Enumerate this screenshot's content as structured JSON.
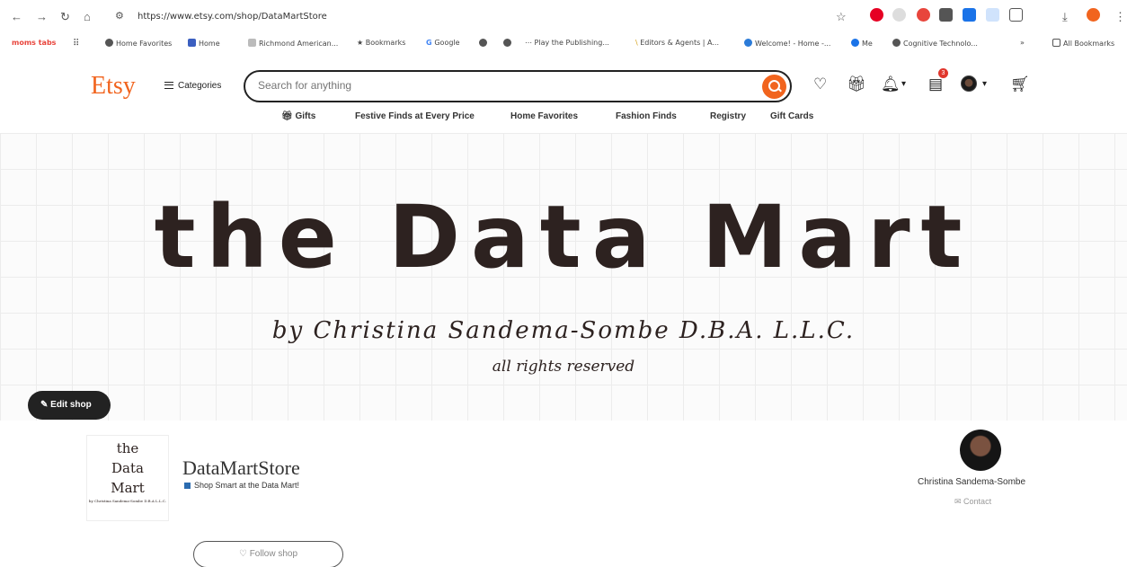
{
  "browser": {
    "url": "https://www.etsy.com/shop/DataMartStore",
    "bookmarks": [
      "moms tabs",
      "Home Favorites",
      "Home",
      "Richmond American...",
      "Bookmarks",
      "Google",
      "Play the Publishing...",
      "Editors & Agents | A...",
      "Welcome! - Home -...",
      "Me",
      "Cognitive Technolo...",
      "»",
      "All Bookmarks"
    ],
    "colors": {
      "moms_tabs": "#e8453c"
    }
  },
  "header": {
    "logo": "Etsy",
    "categories": "Categories",
    "search_placeholder": "Search for anything",
    "cart_badge": "3",
    "colors": {
      "brand": "#f1641e"
    }
  },
  "subnav": [
    "Gifts",
    "Festive Finds at Every Price",
    "Home Favorites",
    "Fashion Finds",
    "Registry",
    "Gift Cards"
  ],
  "banner": {
    "title": "the Data Mart",
    "subtitle": "by Christina Sandema-Sombe D.B.A. L.L.C.",
    "rights": "all rights reserved"
  },
  "edit_shop": "Edit shop",
  "shop": {
    "logo_lines": [
      "the",
      "Data",
      "Mart"
    ],
    "logo_small": "by Christina Sandema-Sombe D.B.A L.L.C.",
    "name": "DataMartStore",
    "tagline": "Shop Smart at the Data Mart!",
    "follow": "Follow shop"
  },
  "owner": {
    "name": "Christina Sandema-Sombe",
    "contact": "Contact"
  }
}
